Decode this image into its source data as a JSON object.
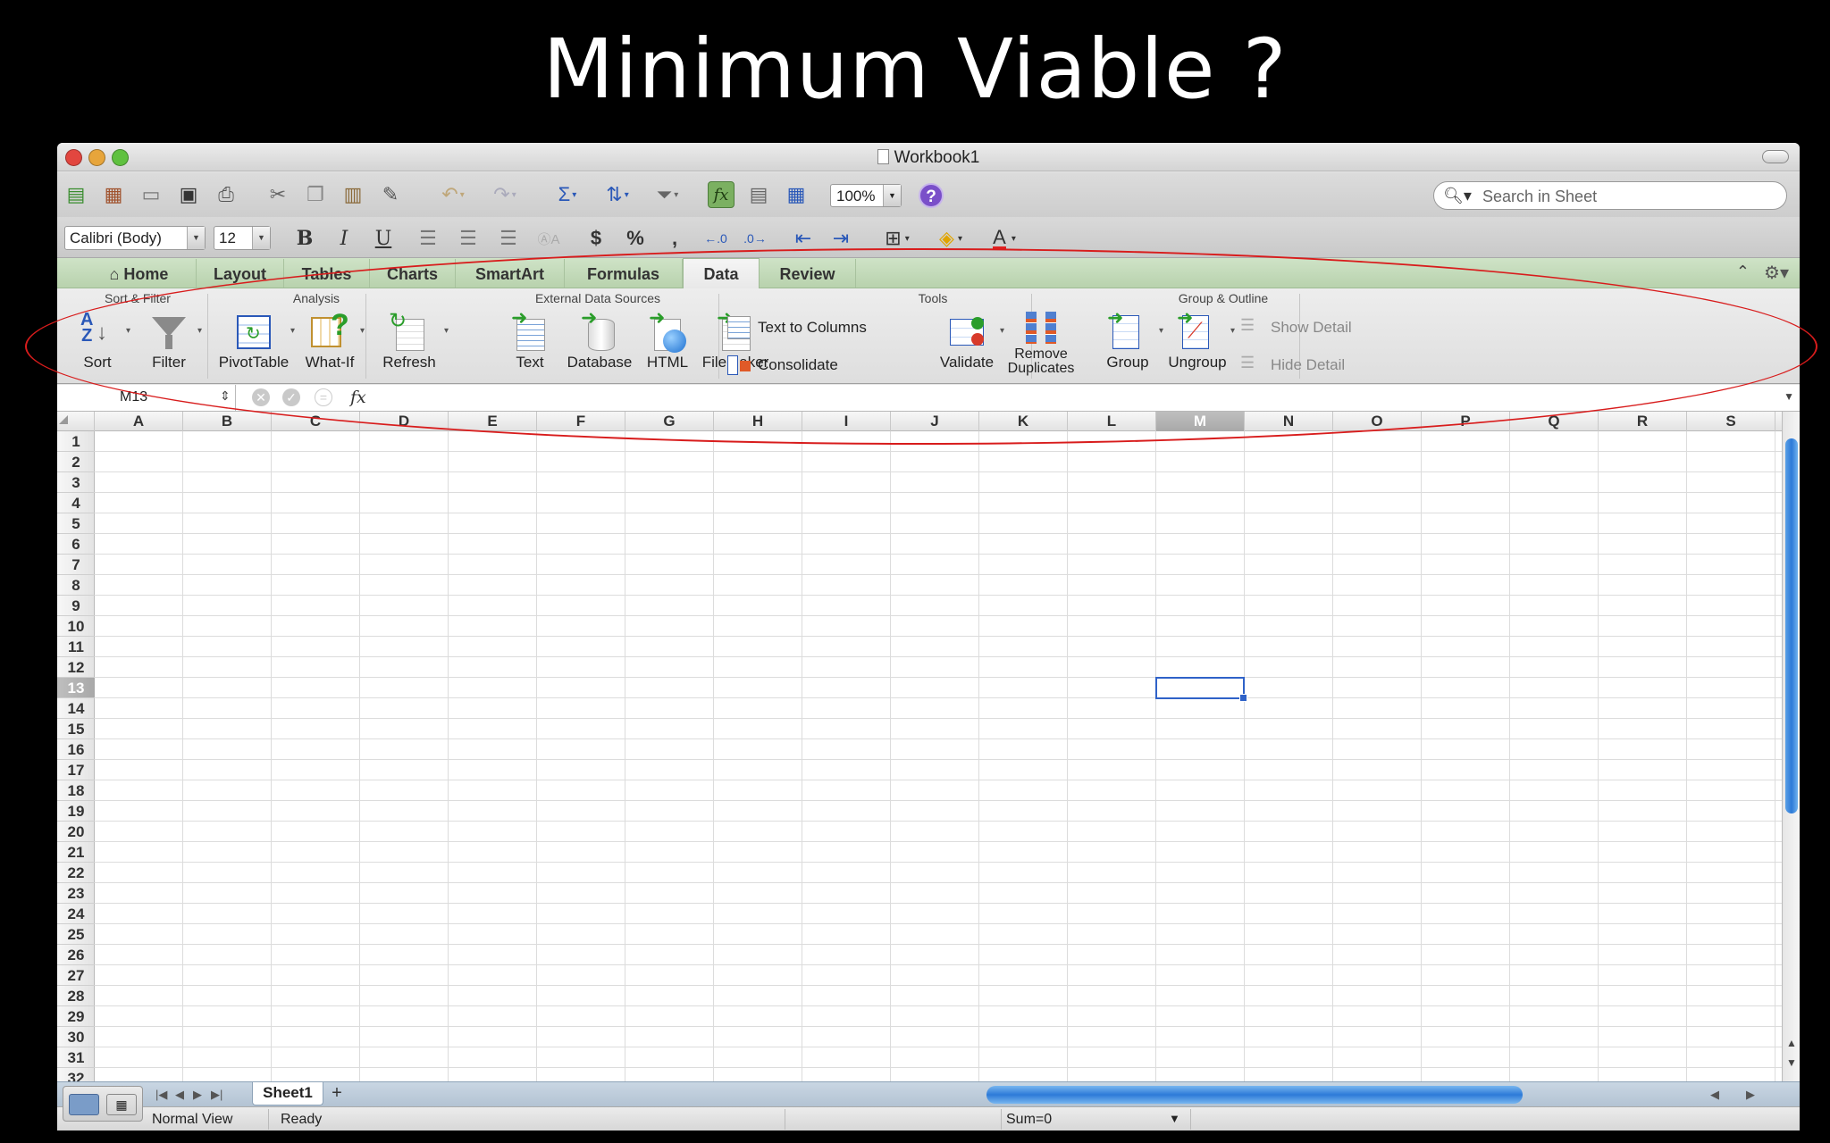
{
  "slide": {
    "title": "Minimum Viable ?"
  },
  "window": {
    "title": "Workbook1"
  },
  "toolbar": {
    "zoom": "100%",
    "help": "?",
    "search_placeholder": "Search in Sheet"
  },
  "format": {
    "font": "Calibri (Body)",
    "size": "12",
    "bold": "B",
    "italic": "I",
    "underline": "U",
    "currency": "$",
    "percent": "%",
    "comma": ",",
    "font_color": "A"
  },
  "tabs": [
    "Home",
    "Layout",
    "Tables",
    "Charts",
    "SmartArt",
    "Formulas",
    "Data",
    "Review"
  ],
  "active_tab": "Data",
  "ribbon": {
    "groups": {
      "sort_filter": "Sort & Filter",
      "analysis": "Analysis",
      "external": "External Data Sources",
      "tools": "Tools",
      "group_outline": "Group & Outline"
    },
    "buttons": {
      "sort": "Sort",
      "filter": "Filter",
      "pivottable": "PivotTable",
      "whatif": "What-If",
      "refresh": "Refresh",
      "text": "Text",
      "database": "Database",
      "html": "HTML",
      "filemaker": "FileMaker",
      "validate": "Validate",
      "remove_duplicates": "Remove Duplicates",
      "group": "Group",
      "ungroup": "Ungroup"
    },
    "small": {
      "text_to_columns": "Text to Columns",
      "consolidate": "Consolidate",
      "show_detail": "Show Detail",
      "hide_detail": "Hide Detail"
    }
  },
  "formula_bar": {
    "name_box": "M13",
    "fx": "fx",
    "value": ""
  },
  "columns": [
    "A",
    "B",
    "C",
    "D",
    "E",
    "F",
    "G",
    "H",
    "I",
    "J",
    "K",
    "L",
    "M",
    "N",
    "O",
    "P",
    "Q",
    "R",
    "S"
  ],
  "selected_column": "M",
  "rows": [
    "1",
    "2",
    "3",
    "4",
    "5",
    "6",
    "7",
    "8",
    "9",
    "10",
    "11",
    "12",
    "13",
    "14",
    "15",
    "16",
    "17",
    "18",
    "19",
    "20",
    "21",
    "22",
    "23",
    "24",
    "25",
    "26",
    "27",
    "28",
    "29",
    "30",
    "31",
    "32"
  ],
  "selected_row": "13",
  "sheet_tab": "Sheet1",
  "status": {
    "view": "Normal View",
    "state": "Ready",
    "sum": "Sum=0"
  },
  "colors": {
    "accent": "#2f62c8",
    "annotation": "#d81c1c",
    "tab_bar": "#b8d2ad"
  }
}
